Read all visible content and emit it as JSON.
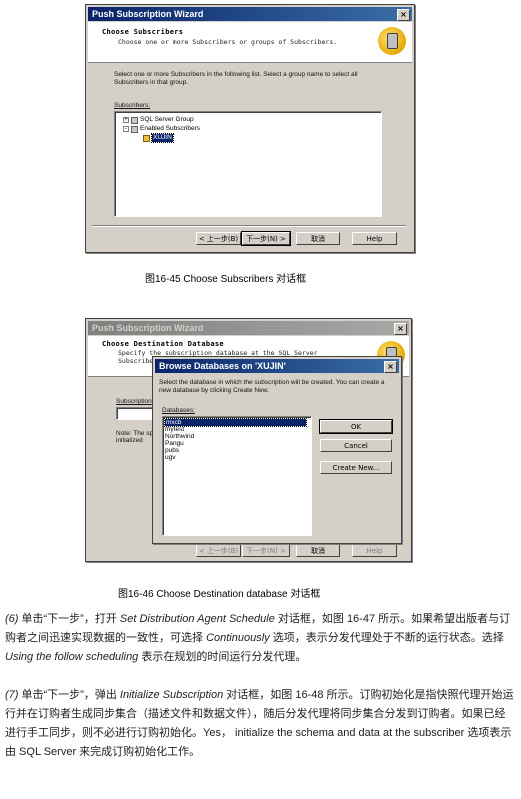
{
  "dialog1": {
    "title": "Push Subscription Wizard",
    "header_title": "Choose Subscribers",
    "header_subtitle": "Choose one or more Subscribers or groups of Subscribers.",
    "instruction": "Select one or more Subscribers in the following list. Select a group name to select all Subscribers in that group.",
    "subscribers_label": "Subscribers:",
    "tree": [
      {
        "label": "SQL Server Group",
        "expander": "+"
      },
      {
        "label": "Enabled Subscribers",
        "expander": "-"
      },
      {
        "label": "XUJIN",
        "selected": true
      }
    ],
    "buttons": {
      "back": "< 上一步(B)",
      "next": "下一步(N) >",
      "cancel": "取消",
      "help": "Help"
    }
  },
  "caption1": "图16-45  Choose Subscribers  对话框",
  "dialog2": {
    "title": "Push Subscription Wizard",
    "header_title": "Choose Destination Database",
    "header_subtitle_1": "Specify the subscription database at the SQL Server",
    "header_subtitle_2": "Subscriber",
    "left_label": "Subscription",
    "note_1": "Note: The sp",
    "note_2": "initialized",
    "buttons": {
      "back": "< 上一步(B)",
      "next": "下一步(N) >",
      "cancel": "取消",
      "help": "Help"
    }
  },
  "browse": {
    "title": "Browse Databases on 'XUJIN'",
    "instruction": "Select the database in which the subscription will be created. You can create a new database by clicking Create New.",
    "databases_label": "Databases:",
    "databases": [
      "mxcb",
      "mytest",
      "Northwind",
      "Pangu",
      "pubs",
      "ugv"
    ],
    "selected_index": 0,
    "buttons": {
      "ok": "OK",
      "cancel": "Cancel",
      "create": "Create New..."
    }
  },
  "caption2": "图16-46  Choose Destination database   对话框",
  "paragraphs": {
    "p6_num": "(6)",
    "p6_a": "单击“下一步”，打开 ",
    "p6_b": "Set Distribution Agent Schedule",
    "p6_c": " 对话框，如图 16-47 所示。如果希望出版者与订购者之间迅速实现数据的一致性，可选择 ",
    "p6_d": "Continuously",
    "p6_e": " 选项，表示分发代理处于不断的运行状态。选择 ",
    "p6_f": "Using the follow scheduling",
    "p6_g": " 表示在规划的时间运行分发代理。",
    "p7_num": "(7)",
    "p7_a": "单击“下一步”，弹出 ",
    "p7_b": "Initialize Subscription",
    "p7_c": " 对话框，如图 16-48 所示。订购初始化是指快照代理开始运行并在订购者生成同步集合（描述文件和数据文件），随后分发代理将同步集合分发到订购者。如果已经进行手工同步，则不必进行订购初始化。Yes， initialize the schema and data at the subscriber 选项表示由 SQL Server 来完成订购初始化工作。"
  }
}
